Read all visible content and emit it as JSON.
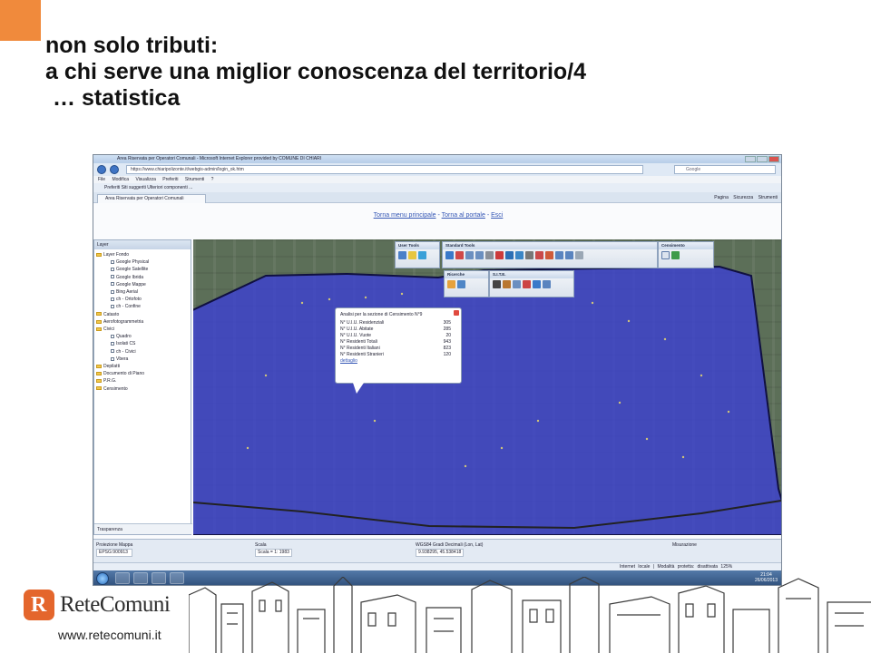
{
  "slide": {
    "title_line1": "non solo tributi:",
    "title_line2": "a chi serve una miglior conoscenza del territorio/4",
    "title_line3": "… statistica",
    "accent_color": "#f08a3c"
  },
  "browser": {
    "window_title": "Area Riservata per Operatori Comunali - Microsoft Internet Explorer provided by COMUNE DI CHIARI",
    "address": "https://www.chiaripolizonte.it/webgis-admin/login_ok.htm",
    "search_placeholder": "Google",
    "menu": "File Modifica Visualizza Preferiti Strumenti ?",
    "favorites_bar": "Preferiti   Siti suggeriti   Ulteriori componenti ...",
    "tab_label": "Area Riservata per Operatori Comunali",
    "tab_tools": "Pagina  Sicurezza  Strumenti"
  },
  "portal": {
    "link_home": "Torna menu principale",
    "sep": " - ",
    "link_portal": "Torna al portale",
    "link_exit": "Esci"
  },
  "layers": {
    "title": "Layer",
    "items": [
      {
        "label": "Layer Fondo",
        "level": 0,
        "type": "folder"
      },
      {
        "label": "Google Physical",
        "level": 1,
        "type": "check"
      },
      {
        "label": "Google Satellite",
        "level": 1,
        "type": "check"
      },
      {
        "label": "Google Ibrida",
        "level": 1,
        "type": "check"
      },
      {
        "label": "Google Mappe",
        "level": 1,
        "type": "check"
      },
      {
        "label": "Bing Aerial",
        "level": 1,
        "type": "check"
      },
      {
        "label": "ch - Ortofoto",
        "level": 1,
        "type": "check"
      },
      {
        "label": "ch - Confine",
        "level": 1,
        "type": "check"
      },
      {
        "label": "Catasto",
        "level": 0,
        "type": "folder"
      },
      {
        "label": "Aerofotogrammetria",
        "level": 0,
        "type": "folder"
      },
      {
        "label": "Civici",
        "level": 0,
        "type": "folder"
      },
      {
        "label": "Quadro",
        "level": 1,
        "type": "check"
      },
      {
        "label": "Isolati CS",
        "level": 1,
        "type": "check"
      },
      {
        "label": "ch - Civici",
        "level": 1,
        "type": "check"
      },
      {
        "label": "Vbera",
        "level": 1,
        "type": "check"
      },
      {
        "label": "Depilatti",
        "level": 0,
        "type": "folder"
      },
      {
        "label": "Documento di Piano",
        "level": 0,
        "type": "folder"
      },
      {
        "label": "P.R.G.",
        "level": 0,
        "type": "folder"
      },
      {
        "label": "Censimento",
        "level": 0,
        "type": "folder"
      }
    ],
    "transparency": "Trasparenza"
  },
  "toolbars": {
    "user_tools": "User Tools",
    "standard_tools": "Standard Tools",
    "censimento": "Censimento",
    "ricerche": "Ricerche",
    "site": "S.I.T.E."
  },
  "popup": {
    "title": "Analisi per la sezione di Censimento N°9",
    "rows": [
      {
        "label": "N° U.I.U. Residenziali",
        "value": "305"
      },
      {
        "label": "N° U.I.U. Abitate",
        "value": "285"
      },
      {
        "label": "N° U.I.U. Vuote",
        "value": "20"
      },
      {
        "label": "N° Residenti Totali",
        "value": "943"
      },
      {
        "label": "N° Residenti Italiani",
        "value": "823"
      },
      {
        "label": "N° Residenti Stranieri",
        "value": "120"
      }
    ],
    "link": "dettaglio"
  },
  "statusbar": {
    "proj_label": "Proiezione Mappa",
    "proj_value": "EPSG:900913",
    "scale_label": "Scala",
    "scale_value": "Scala = 1: 1983",
    "coord_label": "WGS84 Gradi Decimali (Lon, Lat)",
    "coord_value": "9.938295, 45.538418",
    "measure_label": "Misurazione"
  },
  "ie_status": {
    "zone": "Internet locale | Modalità protetta: disattivata",
    "zoom": "125%"
  },
  "taskbar": {
    "time": "21:04",
    "date": "26/06/2013"
  },
  "footer": {
    "brand": "ReteComuni",
    "logo_letter": "R",
    "url": "www.retecomuni.it",
    "brand_color": "#e4662c"
  }
}
